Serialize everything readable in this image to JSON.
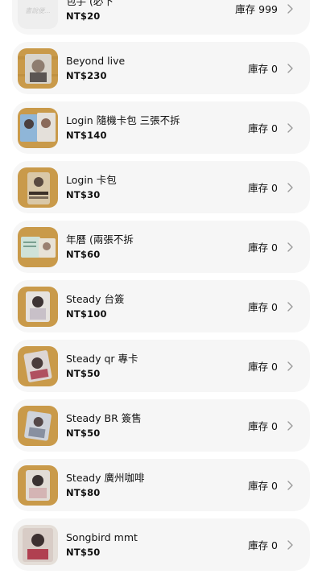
{
  "products": [
    {
      "name": "包手 (必下",
      "price": "NT$20",
      "stock": "庫存 999",
      "thumb": "placeholder"
    },
    {
      "name": "Beyond live",
      "price": "NT$230",
      "stock": "庫存 0",
      "thumb": "photo-card"
    },
    {
      "name": "Login 隨機卡包 三張不拆",
      "price": "NT$140",
      "stock": "庫存 0",
      "thumb": "photo-card"
    },
    {
      "name": "Login 卡包",
      "price": "NT$30",
      "stock": "庫存 0",
      "thumb": "photo-card"
    },
    {
      "name": "年曆 (兩張不拆",
      "price": "NT$60",
      "stock": "庫存 0",
      "thumb": "photo-card"
    },
    {
      "name": "Steady 台簽",
      "price": "NT$100",
      "stock": "庫存 0",
      "thumb": "photo-card"
    },
    {
      "name": "Steady qr 專卡",
      "price": "NT$50",
      "stock": "庫存 0",
      "thumb": "photo-card"
    },
    {
      "name": "Steady BR 簽售",
      "price": "NT$50",
      "stock": "庫存 0",
      "thumb": "photo-card"
    },
    {
      "name": "Steady 廣州咖啡",
      "price": "NT$80",
      "stock": "庫存 0",
      "thumb": "photo-card"
    },
    {
      "name": "Songbird mmt",
      "price": "NT$50",
      "stock": "庫存 0",
      "thumb": "photo-card"
    }
  ],
  "placeholder_thumb_text": "書說便...",
  "icons": {
    "chevron": "chevron-right-icon"
  },
  "colors": {
    "card_bg": "#f6f6f6",
    "text": "#111111",
    "chevron": "#9a9a9a",
    "wood": "#c99a4a"
  }
}
